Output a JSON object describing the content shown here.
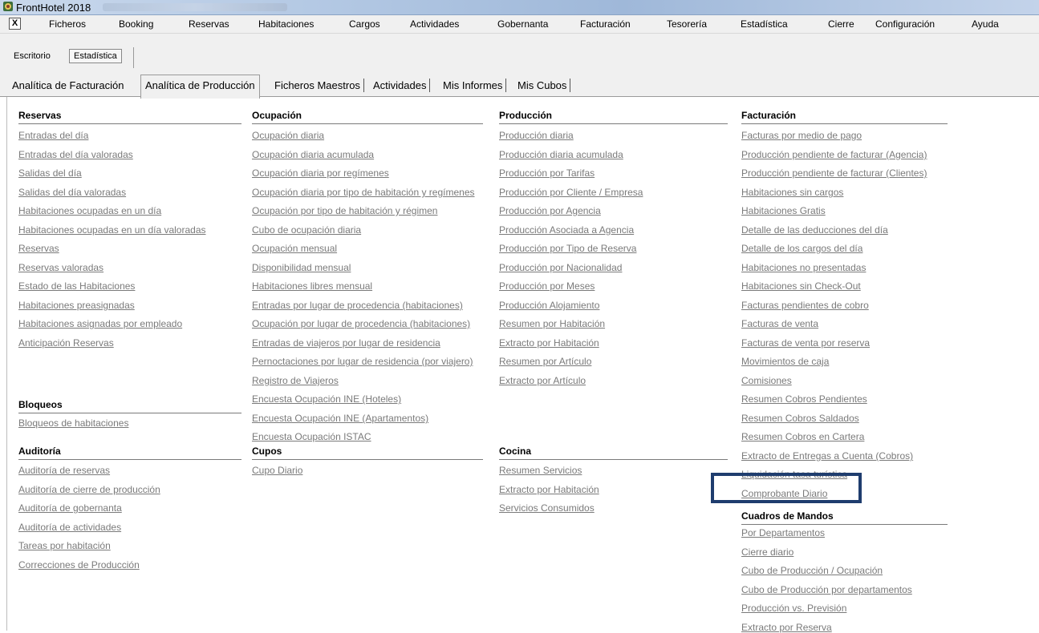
{
  "window": {
    "title": "FrontHotel 2018",
    "brand_color": "#1f3d6e"
  },
  "menu": {
    "close_glyph": "X",
    "items": [
      "Ficheros",
      "Booking",
      "Reservas",
      "Habitaciones",
      "Cargos",
      "Actividades",
      "Gobernanta",
      "Facturación",
      "Tesorería",
      "Estadística",
      "Cierre",
      "Configuración",
      "Ayuda"
    ]
  },
  "toolbar": {
    "escritorio": "Escritorio",
    "estadistica": "Estadística"
  },
  "tabs": [
    "Analítica de Facturación",
    "Analítica de Producción",
    "Ficheros Maestros",
    "Actividades",
    "Mis Informes",
    "Mis Cubos"
  ],
  "active_tab_index": 1,
  "sections": {
    "reservas": {
      "title": "Reservas",
      "links": [
        "Entradas del día",
        "Entradas del día valoradas",
        "Salidas del día",
        "Salidas del día valoradas",
        "Habitaciones ocupadas en un día",
        "Habitaciones ocupadas en un día valoradas",
        "Reservas",
        "Reservas valoradas",
        "Estado de las Habitaciones",
        "Habitaciones preasignadas",
        "Habitaciones asignadas por empleado",
        "Anticipación Reservas"
      ]
    },
    "bloqueos": {
      "title": "Bloqueos",
      "links": [
        "Bloqueos de habitaciones"
      ]
    },
    "auditoria": {
      "title": "Auditoría",
      "links": [
        "Auditoría de reservas",
        "Auditoría de cierre de producción",
        "Auditoría de gobernanta",
        "Auditoría de actividades",
        "Tareas por habitación",
        "Correcciones de Producción"
      ]
    },
    "ocupacion": {
      "title": "Ocupación",
      "links": [
        "Ocupación diaria",
        "Ocupación diaria acumulada",
        "Ocupación diaria por regímenes",
        "Ocupación diaria por tipo de habitación y regímenes",
        "Ocupación por tipo de habitación y régimen",
        "Cubo de ocupación diaria",
        "Ocupación mensual",
        "Disponibilidad mensual",
        "Habitaciones libres mensual",
        "Entradas por lugar de procedencia (habitaciones)",
        "Ocupación por lugar de procedencia (habitaciones)",
        "Entradas de viajeros por lugar de residencia",
        "Pernoctaciones por lugar de residencia (por viajero)",
        "Registro de Viajeros",
        "Encuesta Ocupación INE (Hoteles)",
        "Encuesta Ocupación INE (Apartamentos)",
        "Encuesta Ocupación ISTAC"
      ]
    },
    "cupos": {
      "title": "Cupos",
      "links": [
        "Cupo Diario"
      ]
    },
    "produccion": {
      "title": "Producción",
      "links": [
        "Producción diaria",
        "Producción diaria acumulada",
        "Producción por Tarifas",
        "Producción por Cliente / Empresa",
        "Producción por Agencia",
        "Producción Asociada a Agencia",
        "Producción por Tipo de Reserva",
        "Producción por Nacionalidad",
        "Producción por Meses",
        "Producción Alojamiento",
        "Resumen por Habitación",
        "Extracto por Habitación",
        "Resumen por Artículo",
        "Extracto por Artículo"
      ]
    },
    "cocina": {
      "title": "Cocina",
      "links": [
        "Resumen Servicios",
        "Extracto por Habitación",
        "Servicios Consumidos"
      ]
    },
    "facturacion": {
      "title": "Facturación",
      "links": [
        "Facturas por medio de pago",
        "Producción pendiente de facturar  (Agencia)",
        "Producción pendiente de facturar (Clientes)",
        "Habitaciones sin cargos",
        "Habitaciones Gratis",
        "Detalle de las deducciones del día",
        "Detalle de los cargos del día",
        "Habitaciones no presentadas",
        "Habitaciones sin Check-Out",
        "Facturas pendientes de cobro",
        "Facturas de venta",
        "Facturas de venta por reserva",
        "Movimientos de caja",
        "Comisiones",
        "Resumen Cobros Pendientes",
        "Resumen Cobros Saldados",
        "Resumen Cobros en Cartera",
        "Extracto de Entregas a Cuenta (Cobros)",
        "Liquidación tasa turística",
        "Comprobante Diario"
      ]
    },
    "cuadros": {
      "title": "Cuadros de Mandos",
      "links": [
        "Por Departamentos",
        "Cierre diario",
        "Cubo de Producción / Ocupación",
        "Cubo de Producción por departamentos",
        "Producción vs. Previsión",
        "Extracto por Reserva"
      ]
    }
  }
}
